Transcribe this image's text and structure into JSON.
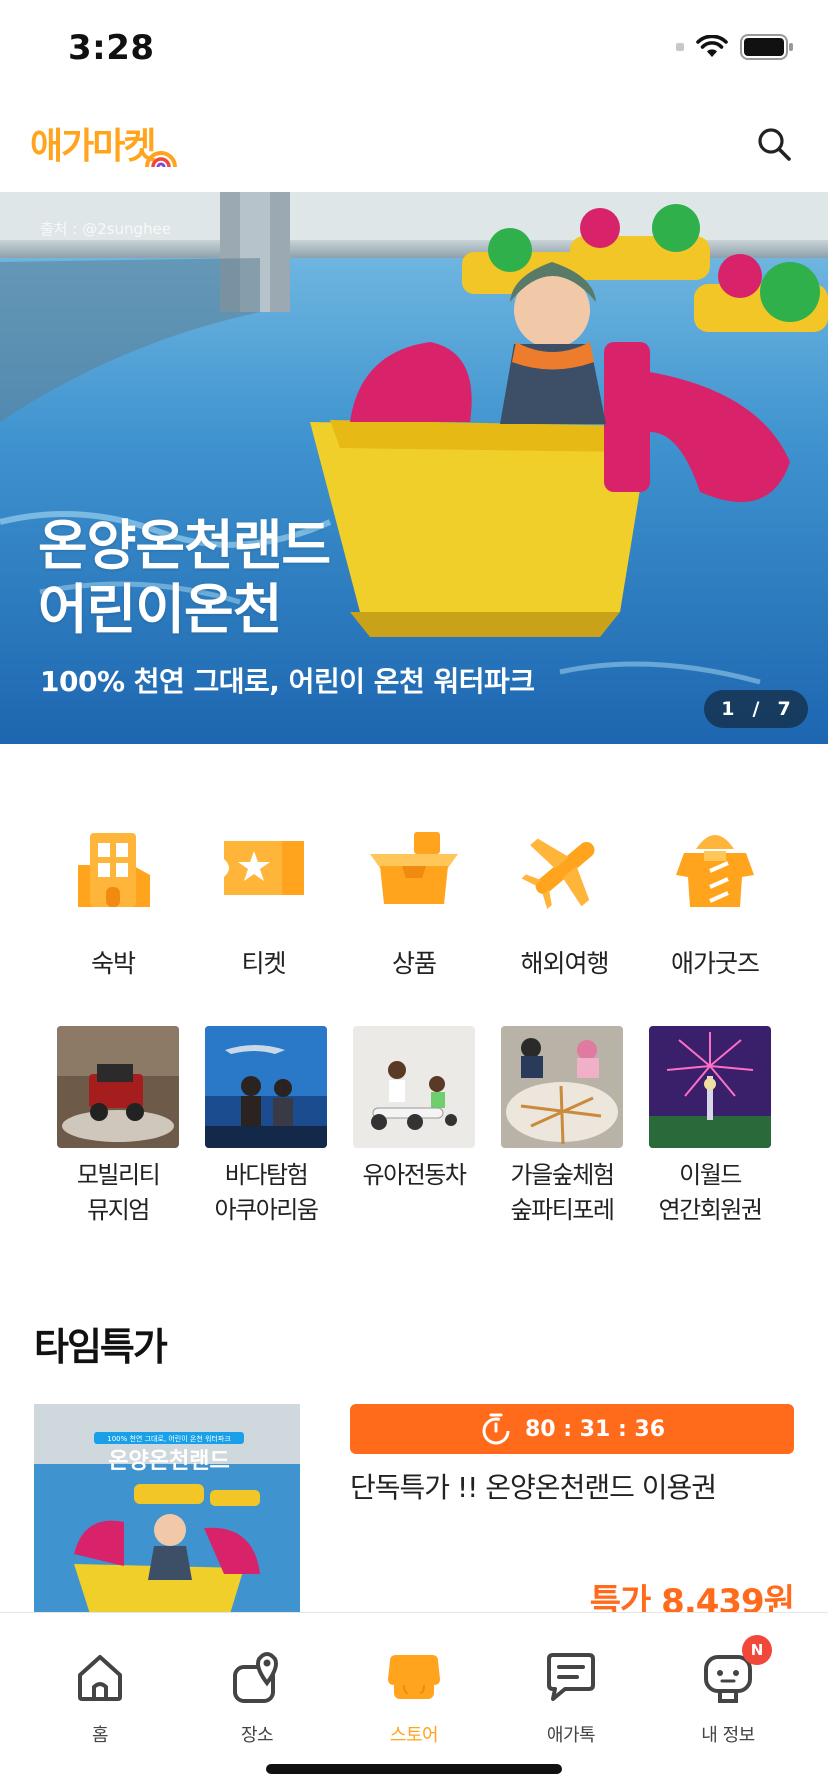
{
  "status_bar": {
    "time": "3:28"
  },
  "header": {
    "logo_text": "애가마켓",
    "search_icon": "search-icon"
  },
  "hero": {
    "credit": "출처 : @2sunghee",
    "title_line1": "온양온천랜드",
    "title_line2": "어린이온천",
    "subtitle": "100% 천연 그대로, 어린이 온천 워터파크",
    "pager_current": "1",
    "pager_sep": "/",
    "pager_total": "7"
  },
  "categories": [
    {
      "label": "숙박",
      "icon": "building-icon"
    },
    {
      "label": "티켓",
      "icon": "ticket-icon"
    },
    {
      "label": "상품",
      "icon": "box-icon"
    },
    {
      "label": "해외여행",
      "icon": "airplane-icon"
    },
    {
      "label": "애가굿즈",
      "icon": "raincoat-icon"
    }
  ],
  "places": [
    {
      "line1": "모빌리티",
      "line2": "뮤지엄"
    },
    {
      "line1": "바다탐험",
      "line2": "아쿠아리움"
    },
    {
      "line1": "유아전동차",
      "line2": ""
    },
    {
      "line1": "가을숲체험",
      "line2": "숲파티포레"
    },
    {
      "line1": "이월드",
      "line2": "연간회원권"
    }
  ],
  "time_deal": {
    "section_title": "타임특가",
    "timer": "80 : 31 : 36",
    "title": "단독특가 !! 온양온천랜드 이용권",
    "price": "특가 8,439원",
    "thumb_banner": "100% 천연 그대로, 어린이 온천 워터파크",
    "thumb_title": "온양온천랜드"
  },
  "tab_bar": {
    "tabs": [
      {
        "label": "홈",
        "icon": "home-icon"
      },
      {
        "label": "장소",
        "icon": "location-icon"
      },
      {
        "label": "스토어",
        "icon": "store-icon"
      },
      {
        "label": "애가톡",
        "icon": "chat-icon"
      },
      {
        "label": "내 정보",
        "icon": "profile-icon"
      }
    ],
    "active_tab": "스토어",
    "badge": "N"
  },
  "colors": {
    "brand": "#FFA41C",
    "accent": "#FF6B1A",
    "badge": "#F2483A"
  }
}
